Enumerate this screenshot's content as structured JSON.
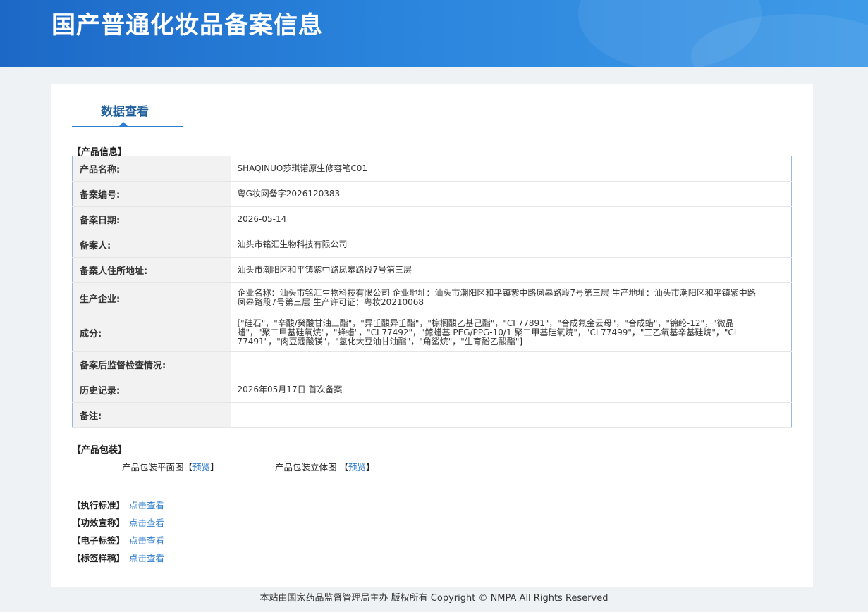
{
  "header": {
    "title": "国产普通化妆品备案信息"
  },
  "tab": {
    "label": "数据查看"
  },
  "product_info": {
    "section_title": "【产品信息】",
    "rows": [
      {
        "label": "产品名称:",
        "value": "SHAQINUO莎琪诺原生修容笔C01"
      },
      {
        "label": "备案编号:",
        "value": "粤G妆网备字2026120383"
      },
      {
        "label": "备案日期:",
        "value": "2026-05-14"
      },
      {
        "label": "备案人:",
        "value": "汕头市铭汇生物科技有限公司"
      },
      {
        "label": "备案人住所地址:",
        "value": "汕头市潮阳区和平镇紫中路凤皋路段7号第三层"
      },
      {
        "label": "生产企业:",
        "value": "企业名称：汕头市铭汇生物科技有限公司 企业地址：汕头市潮阳区和平镇紫中路凤皋路段7号第三层 生产地址：汕头市潮阳区和平镇紫中路凤皋路段7号第三层 生产许可证：粤妆20210068"
      },
      {
        "label": "成分:",
        "value": "[\"硅石\"，\"辛酸/癸酸甘油三酯\"，\"异壬酸异壬酯\"，\"棕榈酸乙基己酯\"，\"CI 77891\"，\"合成氟金云母\"，\"合成蜡\"，\"锦纶-12\"，\"微晶蜡\"，\"聚二甲基硅氧烷\"，\"蜂蜡\"，\"CI 77492\"，\"鲸蜡基 PEG/PPG-10/1 聚二甲基硅氧烷\"，\"CI 77499\"，\"三乙氧基辛基硅烷\"，\"CI 77491\"，\"肉豆蔻酸镁\"，\"氢化大豆油甘油酯\"，\"角鲨烷\"，\"生育酚乙酸酯\"]"
      },
      {
        "label": "备案后监督检查情况:",
        "value": ""
      },
      {
        "label": "历史记录:",
        "value": "2026年05月17日 首次备案"
      },
      {
        "label": "备注:",
        "value": ""
      }
    ]
  },
  "packaging": {
    "section_title": "【产品包装】",
    "flat_label": "产品包装平面图【",
    "flat_link": "预览",
    "flat_close": "】",
    "three_d_label": "产品包装立体图 【",
    "three_d_link": "预览",
    "three_d_close": "】"
  },
  "links": [
    {
      "key": "【执行标准】",
      "link": "点击查看"
    },
    {
      "key": "【功效宣称】",
      "link": "点击查看"
    },
    {
      "key": "【电子标签】",
      "link": "点击查看"
    },
    {
      "key": "【标签样稿】",
      "link": "点击查看"
    }
  ],
  "footer": {
    "text": "本站由国家药品监督管理局主办 版权所有 Copyright © NMPA All Rights Reserved"
  },
  "colors": {
    "header_start": "#1c68c6",
    "header_end": "#3f9ae8",
    "link": "#2e7ecf",
    "tab": "#1f5f9e"
  }
}
